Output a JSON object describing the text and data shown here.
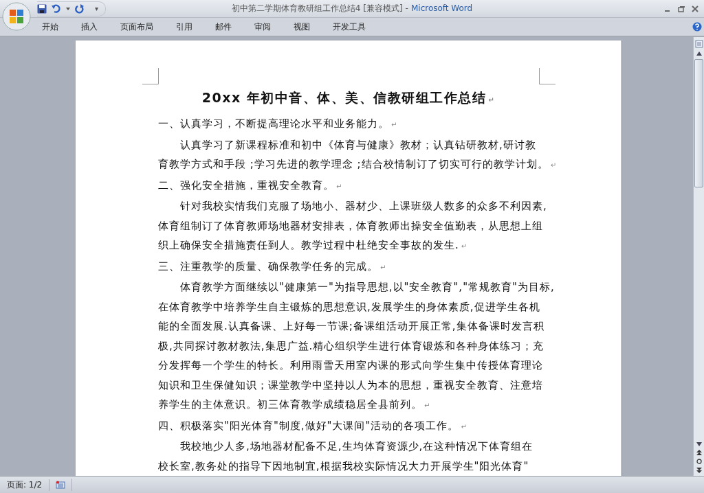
{
  "window": {
    "title": "初中第二学期体育教研组工作总结4 [兼容模式]",
    "separator": "-",
    "app_name": "Microsoft Word"
  },
  "quick_access": {
    "customize_glyph": "▾"
  },
  "tabs": [
    {
      "label": "开始",
      "selected": false
    },
    {
      "label": "插入",
      "selected": false
    },
    {
      "label": "页面布局",
      "selected": false
    },
    {
      "label": "引用",
      "selected": false
    },
    {
      "label": "邮件",
      "selected": false
    },
    {
      "label": "审阅",
      "selected": false
    },
    {
      "label": "视图",
      "selected": false
    },
    {
      "label": "开发工具",
      "selected": false
    }
  ],
  "document": {
    "paragraphs": [
      {
        "kind": "title",
        "lines": [
          "20xx 年初中音、体、美、信教研组工作总结"
        ],
        "end_mark": "↵"
      },
      {
        "kind": "heading",
        "lines": [
          "一、认真学习，不断提高理论水平和业务能力。"
        ],
        "end_mark": "↵"
      },
      {
        "kind": "body",
        "lines": [
          "认真学习了新课程标准和初中《体育与健康》教材；认真钻研教材,研讨教",
          "育教学方式和手段 ;学习先进的教学理念 ;结合校情制订了切实可行的教学计划。"
        ],
        "end_mark": "↵"
      },
      {
        "kind": "heading",
        "lines": [
          "二、强化安全措施，重视安全教育。"
        ],
        "end_mark": "↵"
      },
      {
        "kind": "body",
        "lines": [
          "针对我校实情我们克服了场地小、器材少、上课班级人数多的众多不利因素,",
          "体育组制订了体育教师场地器材安排表，体育教师出操安全值勤表，从思想上组",
          "织上确保安全措施责任到人。教学过程中杜绝安全事故的发生."
        ],
        "end_mark": "↵"
      },
      {
        "kind": "heading",
        "lines": [
          "三、注重教学的质量、确保教学任务的完成。"
        ],
        "end_mark": "↵"
      },
      {
        "kind": "body",
        "lines": [
          "体育教学方面继续以\"健康第一\"为指导思想,以\"安全教育\",\"常规教育\"为目标,",
          "在体育教学中培养学生自主锻炼的思想意识,发展学生的身体素质,促进学生各机",
          "能的全面发展.认真备课、上好每一节课;备课组活动开展正常,集体备课时发言积",
          "极,共同探讨教材教法,集思广益.精心组织学生进行体育锻炼和各种身体练习；充",
          "分发挥每一个学生的特长。利用雨雪天用室内课的形式向学生集中传授体育理论",
          "知识和卫生保健知识；课堂教学中坚持以人为本的思想，重视安全教育、注意培",
          "养学生的主体意识。初三体育教学成绩稳居全县前列。"
        ],
        "end_mark": "↵"
      },
      {
        "kind": "heading",
        "lines": [
          "四、积极落实\"阳光体育\"制度,做好\"大课间\"活动的各项工作。"
        ],
        "end_mark": "↵"
      },
      {
        "kind": "body",
        "lines": [
          "我校地少人多,场地器材配备不足,生均体育资源少,在这种情况下体育组在",
          "校长室,教务处的指导下因地制宜,根据我校实际情况大力开展学生\"阳光体育\""
        ]
      }
    ]
  },
  "status_bar": {
    "page": "页面: 1/2"
  }
}
